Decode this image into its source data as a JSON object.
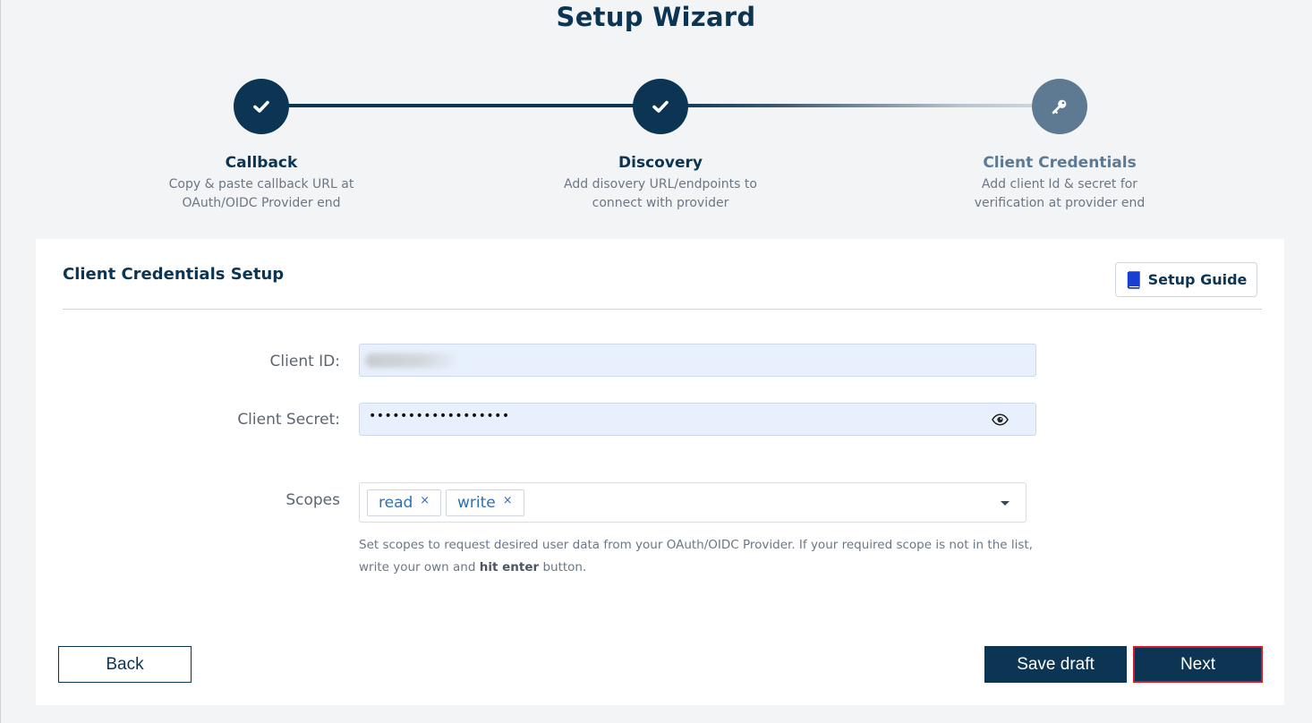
{
  "page": {
    "title": "Setup Wizard"
  },
  "steps": [
    {
      "title": "Callback",
      "desc_line1": "Copy & paste callback URL at",
      "desc_line2": "OAuth/OIDC Provider end",
      "status": "done",
      "icon": "check-icon"
    },
    {
      "title": "Discovery",
      "desc_line1": "Add disovery URL/endpoints to",
      "desc_line2": "connect with provider",
      "status": "done",
      "icon": "check-icon"
    },
    {
      "title": "Client Credentials",
      "desc_line1": "Add client Id & secret for",
      "desc_line2": "verification at provider end",
      "status": "current",
      "icon": "key-icon"
    }
  ],
  "card": {
    "title": "Client Credentials Setup",
    "guide_button": "Setup Guide"
  },
  "form": {
    "client_id_label": "Client ID:",
    "client_secret_label": "Client Secret:",
    "client_secret_value": "••••••••••••••••••",
    "scopes_label": "Scopes",
    "scopes": [
      "read",
      "write"
    ],
    "chip_remove": "×",
    "help_part1": "Set scopes to request desired user data from your OAuth/OIDC Provider. If your required scope is not in the list, write your own and ",
    "help_bold": "hit enter",
    "help_part2": " button."
  },
  "actions": {
    "back": "Back",
    "save_draft": "Save draft",
    "next": "Next"
  },
  "colors": {
    "primary": "#0b3553",
    "pending": "#5e7a93",
    "input_bg": "#e8f0fe",
    "chip_text": "#2f6fb5",
    "next_border": "#d11a2a"
  }
}
